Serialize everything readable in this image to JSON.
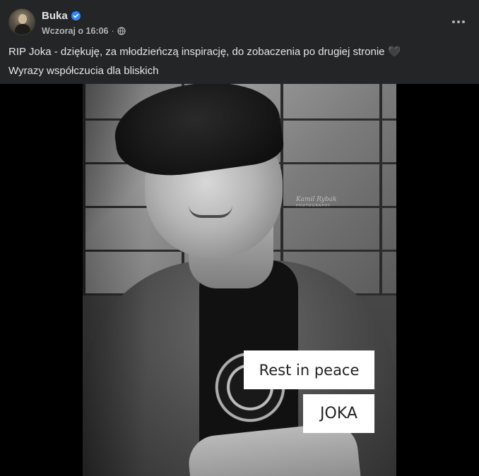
{
  "post": {
    "author": "Buka",
    "verified": true,
    "timestamp": "Wczoraj o 16:06",
    "separator": "·",
    "privacy_icon": "globe-icon",
    "more_icon": "more-dots-icon",
    "text_lines": [
      "RIP Joka - dziękuję, za młodzieńczą inspirację, do zobaczenia po drugiej stronie 🖤",
      "Wyrazy współczucia dla bliskich"
    ]
  },
  "photo": {
    "watermark_script": "Kamil Rybak",
    "watermark_sub": "PHOTOGRAPHY",
    "captions": [
      "Rest in peace",
      "JOKA"
    ]
  },
  "colors": {
    "background": "#242526",
    "text": "#e4e6eb",
    "secondary_text": "#b0b3b8",
    "verified_badge": "#2d88ff"
  }
}
